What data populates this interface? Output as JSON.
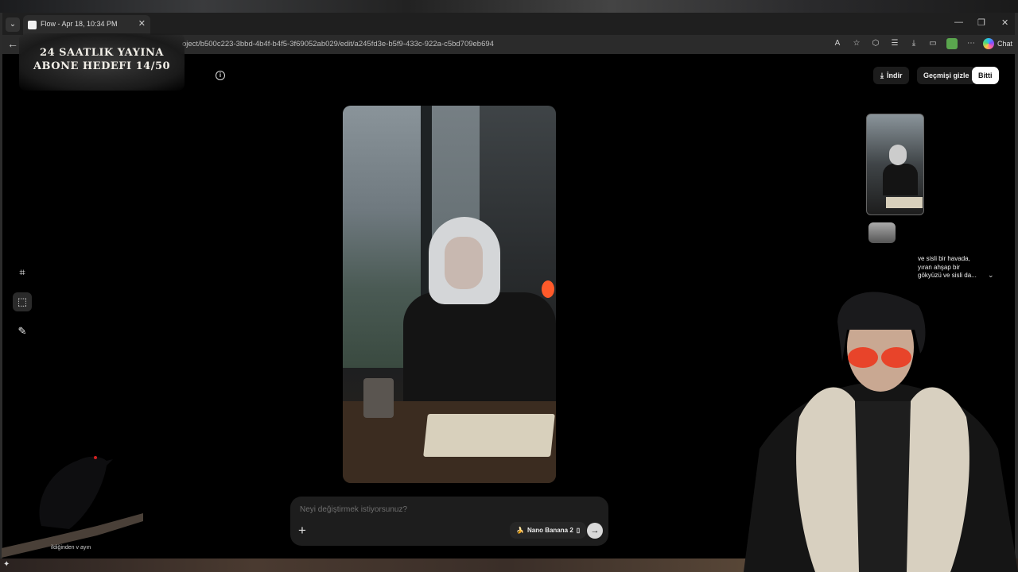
{
  "browser": {
    "tab_title": "Flow - Apr 18, 10:34 PM",
    "url": "oject/b500c223-3bbd-4b4f-b4f5-3f69052ab029/edit/a245fd3e-b5f9-433c-922a-c5bd709eb694",
    "chat_label": "Chat"
  },
  "overlay": {
    "banner_line1": "24 SAATLIK YAYINA",
    "banner_line2": "ABONE HEDEFI 14/50",
    "raven_caption": "ildiğinden v                                 ayın"
  },
  "header": {
    "download_label": "İndir",
    "hide_history_label": "Geçmişi gizle",
    "done_label": "Bitti"
  },
  "prompt": {
    "placeholder": "Neyi değiştirmek istiyorsunuz?",
    "model_label": "Nano Banana 2",
    "model_icon": "🍌"
  },
  "history": {
    "text_lines": [
      "ve sisli bir havada,",
      "yıran ahşap bir",
      "gökyüzü ve sisli da..."
    ]
  },
  "icons": {
    "tab_menu": "chevron-down-icon",
    "back": "arrow-left-icon",
    "info": "info-icon",
    "crop": "crop-icon",
    "select": "selection-icon",
    "edit": "pen-sparkle-icon",
    "send": "arrow-right-icon",
    "add": "plus-icon"
  },
  "colors": {
    "page_bg": "#000000",
    "done_button_bg": "#ffffff",
    "prompt_bg": "#1d1d1d"
  }
}
